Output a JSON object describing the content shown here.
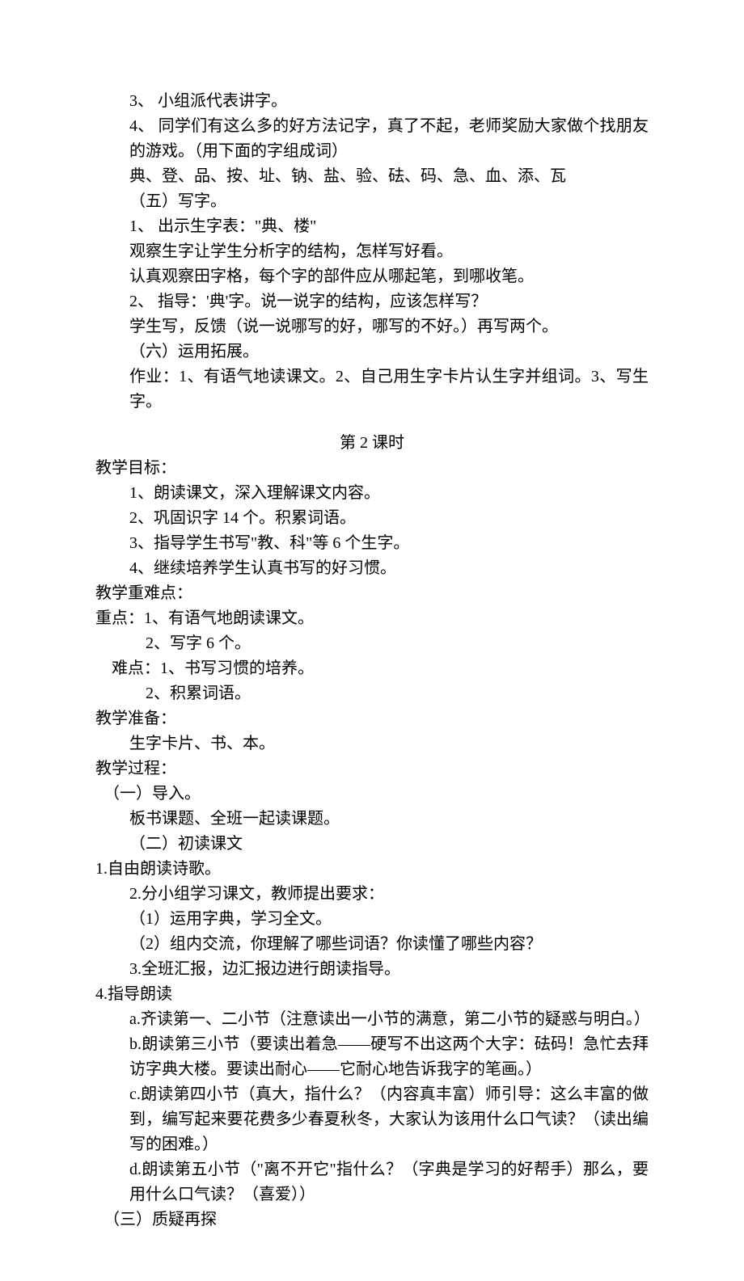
{
  "lines": {
    "l1": "3、 小组派代表讲字。",
    "l2": "4、 同学们有这么多的好方法记字，真了不起，老师奖励大家做个找朋友的游戏。（用下面的字组成词）",
    "l3": "典、登、品、按、址、钠、盐、验、砝、码、急、血、添、瓦",
    "l4": "（五）写字。",
    "l5": "1、 出示生字表：\"典、楼\"",
    "l6": "观察生字让学生分析字的结构，怎样写好看。",
    "l7": "认真观察田字格，每个字的部件应从哪起笔，到哪收笔。",
    "l8": "2、 指导：'典'字。说一说字的结构，应该怎样写？",
    "l9": "学生写，反馈（说一说哪写的好，哪写的不好。）再写两个。",
    "l10": "（六）运用拓展。",
    "l11": "作业：1、有语气地读课文。2、自己用生字卡片认生字并组词。3、写生字。",
    "sectionTitle": "第 2 课时",
    "t1": "教学目标：",
    "t1a": "1、朗读课文，深入理解课文内容。",
    "t1b": "2、巩固识字 14 个。积累词语。",
    "t1c": "3、指导学生书写\"教、科\"等 6 个生字。",
    "t1d": "4、继续培养学生认真书写的好习惯。",
    "t2": "教学重难点：",
    "t2a": "重点：1、有语气地朗读课文。",
    "t2b": "2、写字 6 个。",
    "t2c": "难点：1、书写习惯的培养。",
    "t2d": "2、积累词语。",
    "t3": "教学准备：",
    "t3a": "生字卡片、书、本。",
    "t4": "教学过程：",
    "t4a": "（一）导入。",
    "t4a1": "板书课题、全班一起读课题。",
    "t4b": "（二）初读课文",
    "t4b1": "1.自由朗读诗歌。",
    "t4b2": "2.分小组学习课文，教师提出要求：",
    "t4b3": "（1）运用字典，学习全文。",
    "t4b4": "（2）组内交流，你理解了哪些词语？你读懂了哪些内容？",
    "t4b5": "3.全班汇报，边汇报边进行朗读指导。",
    "t4c": "4.指导朗读",
    "t4c1": "a.齐读第一、二小节（注意读出一小节的满意，第二小节的疑惑与明白。）",
    "t4c2": "b.朗读第三小节（要读出着急——硬写不出这两个大字：砝码！急忙去拜访字典大楼。要读出耐心——它耐心地告诉我字的笔画。）",
    "t4c3": "c.朗读第四小节（真大，指什么？（内容真丰富）师引导：这么丰富的做到，编写起来要花费多少春夏秋冬，大家认为该用什么口气读？（读出编写的困难。）",
    "t4c4": "d.朗读第五小节（\"离不开它\"指什么？（字典是学习的好帮手）那么，要用什么口气读？（喜爱））",
    "t4d": "（三）质疑再探"
  }
}
